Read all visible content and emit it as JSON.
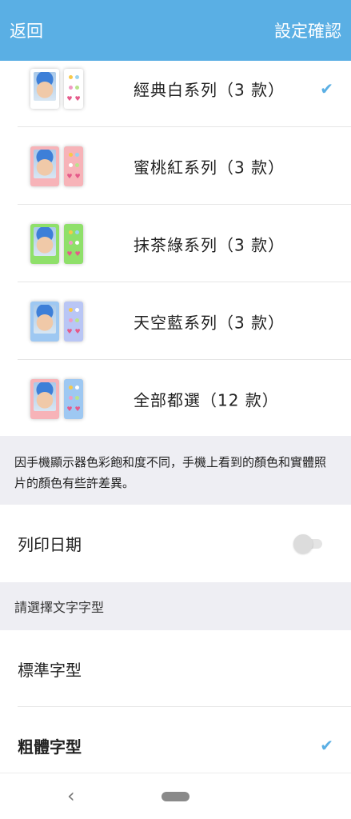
{
  "header": {
    "back_label": "返回",
    "confirm_label": "設定確認",
    "background": "#5aafe4"
  },
  "themes": [
    {
      "label": "經典白系列（3 款）",
      "selected": true,
      "photo_frame": "#ffffff",
      "deco_bg": "#ffffff",
      "dots": [
        "#f7c94a",
        "#9bd3f0",
        "#f09ac3",
        "#b9e38c"
      ]
    },
    {
      "label": "蜜桃紅系列（3 款）",
      "selected": false,
      "photo_frame": "#f7b3b8",
      "deco_bg": "#f7b3b8",
      "dots": [
        "#f7c94a",
        "#9bd3f0",
        "#ffffff",
        "#b9e38c"
      ]
    },
    {
      "label": "抹茶綠系列（3 款）",
      "selected": false,
      "photo_frame": "#8fe06a",
      "deco_bg": "#8fe06a",
      "dots": [
        "#f7c94a",
        "#9bd3f0",
        "#f09ac3",
        "#ffffff"
      ]
    },
    {
      "label": "天空藍系列（3 款）",
      "selected": false,
      "photo_frame": "#9ec8f2",
      "deco_bg": "#b9c6f5",
      "dots": [
        "#f7c94a",
        "#ffffff",
        "#f09ac3",
        "#b9e38c"
      ]
    },
    {
      "label": "全部都選（12 款）",
      "selected": false,
      "photo_frame": "#f7b3b8",
      "deco_bg": "#9ec8f2",
      "dots": [
        "#f7c94a",
        "#ffffff",
        "#f09ac3",
        "#b9e38c"
      ]
    }
  ],
  "notice": {
    "text": "因手機顯示器色彩飽和度不同，手機上看到的顏色和實體照片的顏色有些許差異。"
  },
  "print_date": {
    "label": "列印日期",
    "enabled": false
  },
  "font_section": {
    "header": "請選擇文字字型",
    "options": [
      {
        "label": "標準字型",
        "selected": false
      },
      {
        "label": "粗體字型",
        "selected": true
      }
    ]
  },
  "icons": {
    "check": "check-icon",
    "nav_back": "nav-back-icon",
    "nav_home": "nav-home-pill"
  }
}
